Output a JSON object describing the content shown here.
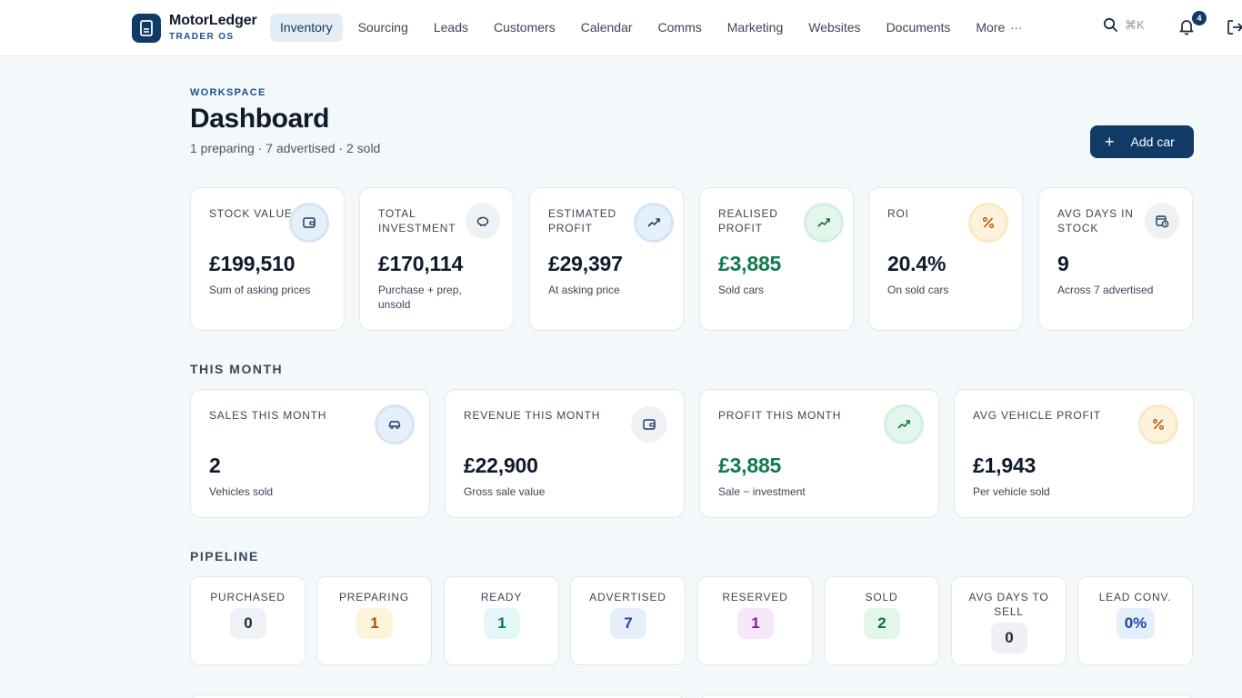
{
  "brand": {
    "name": "MotorLedger",
    "subtitle": "TRADER OS"
  },
  "nav": {
    "items": [
      {
        "label": "Inventory",
        "active": true
      },
      {
        "label": "Sourcing"
      },
      {
        "label": "Leads"
      },
      {
        "label": "Customers"
      },
      {
        "label": "Calendar"
      },
      {
        "label": "Comms"
      },
      {
        "label": "Marketing"
      },
      {
        "label": "Websites"
      },
      {
        "label": "Documents"
      }
    ],
    "more_label": "More",
    "more_glyph": "···",
    "search_shortcut": "⌘K",
    "notifications_count": "4"
  },
  "header": {
    "eyebrow": "WORKSPACE",
    "title": "Dashboard",
    "subtitle": "1 preparing · 7 advertised · 2 sold",
    "add_button": "Add car",
    "add_glyph": "+"
  },
  "kpis": [
    {
      "label": "Stock value",
      "value": "£199,510",
      "desc": "Sum of asking prices",
      "icon": "wallet-icon"
    },
    {
      "label": "Total investment",
      "value": "£170,114",
      "desc": "Purchase + prep, unsold",
      "icon": "piggy-bank-icon"
    },
    {
      "label": "Estimated profit",
      "value": "£29,397",
      "desc": "At asking price",
      "icon": "trending-up-icon"
    },
    {
      "label": "Realised profit",
      "value": "£3,885",
      "desc": "Sold cars",
      "icon": "trending-up-icon",
      "color": "#0f7a4e"
    },
    {
      "label": "ROI",
      "value": "20.4%",
      "desc": "On sold cars",
      "icon": "percent-icon"
    },
    {
      "label": "Avg days in stock",
      "value": "9",
      "desc": "Across 7 advertised",
      "icon": "calendar-clock-icon"
    }
  ],
  "this_month": {
    "title": "THIS MONTH",
    "cards": [
      {
        "label": "Sales this month",
        "value": "2",
        "desc": "Vehicles sold",
        "icon": "car-icon"
      },
      {
        "label": "Revenue this month",
        "value": "£22,900",
        "desc": "Gross sale value",
        "icon": "wallet-icon"
      },
      {
        "label": "Profit this month",
        "value": "£3,885",
        "desc": "Sale − investment",
        "icon": "trending-up-icon",
        "color": "#0f7a4e"
      },
      {
        "label": "Avg vehicle profit",
        "value": "£1,943",
        "desc": "Per vehicle sold",
        "icon": "percent-icon"
      }
    ]
  },
  "pipeline": {
    "title": "PIPELINE",
    "stages": [
      {
        "label": "PURCHASED",
        "value": "0",
        "bg": "#eef2f6",
        "fg": "#1d2b3d"
      },
      {
        "label": "PREPARING",
        "value": "1",
        "bg": "#fdf4dc",
        "fg": "#a0560b"
      },
      {
        "label": "READY",
        "value": "1",
        "bg": "#e2f7f6",
        "fg": "#0e6f70"
      },
      {
        "label": "ADVERTISED",
        "value": "7",
        "bg": "#e6eefb",
        "fg": "#1e47a8"
      },
      {
        "label": "RESERVED",
        "value": "1",
        "bg": "#f5e8fb",
        "fg": "#7b1fa2"
      },
      {
        "label": "SOLD",
        "value": "2",
        "bg": "#e2f6ea",
        "fg": "#0f6e43"
      },
      {
        "label": "AVG DAYS TO SELL",
        "value": "0",
        "bg": "#eef0f3",
        "fg": "#1d2b3d"
      },
      {
        "label": "LEAD CONV.",
        "value": "0%",
        "bg": "#e6eefb",
        "fg": "#1e47a8"
      }
    ]
  }
}
